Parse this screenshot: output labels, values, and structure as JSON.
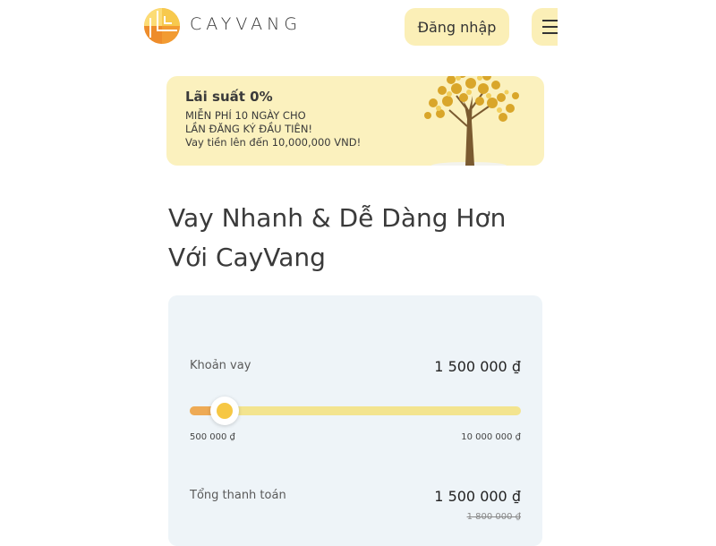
{
  "header": {
    "brand": "CAYVANG",
    "login_label": "Đăng nhập"
  },
  "banner": {
    "title": "Lãi suất 0%",
    "line1": "MIỄN PHÍ 10 NGÀY CHO",
    "line2": "LẦN ĐĂNG KÝ ĐẦU TIÊN!",
    "line3": "Vay tiền lên đến 10,000,000 VND!"
  },
  "headline": {
    "line1": "Vay Nhanh & Dễ Dàng Hơn",
    "line2": "Với CayVang"
  },
  "calculator": {
    "loan_label": "Khoản vay",
    "loan_value": "1 500 000 ₫",
    "slider": {
      "min_label": "500 000 ₫",
      "max_label": "10 000 000 ₫",
      "fraction": 0.105
    },
    "total_label": "Tổng thanh toán",
    "total_value": "1 500 000 ₫",
    "total_old_value": "1 800 000 ₫"
  },
  "colors": {
    "accent_yellow": "#fbefb7",
    "slider_fill": "#eeaa55",
    "slider_track": "#f3e48f",
    "thumb": "#f6c744",
    "card_bg": "#eef4f8"
  },
  "icons": [
    "logo-icon",
    "menu-icon",
    "money-tree-illustration"
  ]
}
